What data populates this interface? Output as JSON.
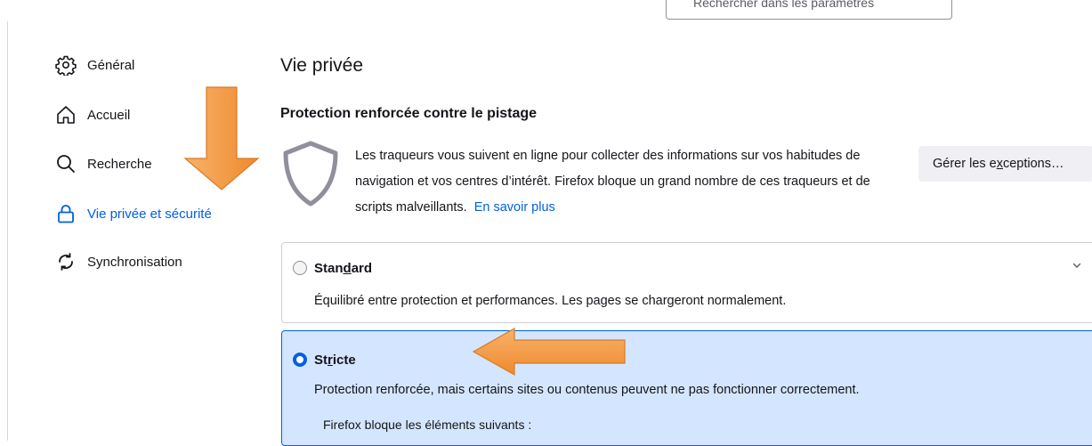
{
  "search": {
    "placeholder": "Rechercher dans les paramètres"
  },
  "sidebar": {
    "items": [
      {
        "label": "Général",
        "icon": "gear-icon"
      },
      {
        "label": "Accueil",
        "icon": "home-icon"
      },
      {
        "label": "Recherche",
        "icon": "search-icon"
      },
      {
        "label": "Vie privée et sécurité",
        "icon": "lock-icon",
        "active": true
      },
      {
        "label": "Synchronisation",
        "icon": "sync-icon"
      }
    ]
  },
  "main": {
    "title": "Vie privée",
    "section_title": "Protection renforcée contre le pistage",
    "description": "Les traqueurs vous suivent en ligne pour collecter des informations sur vos habitudes de navigation et vos centres d’intérêt. Firefox bloque un grand nombre de ces traqueurs et de scripts malveillants.",
    "learn_more": "En savoir plus",
    "exceptions_button": {
      "pre": "Gérer les e",
      "accel": "x",
      "post": "ceptions…"
    },
    "options": [
      {
        "title_pre": "Stan",
        "title_accel": "d",
        "title_post": "ard",
        "description": "Équilibré entre protection et performances. Les pages se chargeront normalement.",
        "selected": false
      },
      {
        "title_pre": "St",
        "title_accel": "r",
        "title_post": "icte",
        "description": "Protection renforcée, mais certains sites ou contenus peuvent ne pas fonctionner correctement.",
        "selected": true,
        "blocks_intro": "Firefox bloque les éléments suivants :"
      }
    ]
  },
  "colors": {
    "accent": "#0061e0",
    "selected_bg": "#d4e6ff",
    "annotation_arrow": "#f5923e"
  }
}
